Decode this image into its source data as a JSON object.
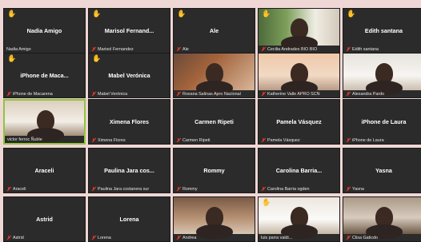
{
  "participants": [
    {
      "display": "Nadia Amigo",
      "label": "Nadia Amigo",
      "hand": true,
      "muted": false,
      "video": false
    },
    {
      "display": "Marisol  Fernand...",
      "label": "Marisol Fernandez",
      "hand": true,
      "muted": true,
      "video": false
    },
    {
      "display": "Ale",
      "label": "Ale",
      "hand": true,
      "muted": true,
      "video": false
    },
    {
      "display": "",
      "label": "Cecilia Andrades BIO BIO",
      "hand": true,
      "muted": true,
      "video": true,
      "bg": "bg-green"
    },
    {
      "display": "Edith santana",
      "label": "Edith santana",
      "hand": true,
      "muted": true,
      "video": false
    },
    {
      "display": "iPhone de Maca...",
      "label": "iPhone de Macarena",
      "hand": true,
      "muted": true,
      "video": false
    },
    {
      "display": "Mabel Verónica",
      "label": "Mabel Verónica",
      "hand": true,
      "muted": true,
      "video": false
    },
    {
      "display": "",
      "label": "Roxana Salinas Apro Nacional",
      "hand": false,
      "muted": true,
      "video": true,
      "bg": "bg-orange"
    },
    {
      "display": "",
      "label": "Katherine Valle APRO SCN",
      "hand": false,
      "muted": true,
      "video": true,
      "bg": "bg-peach"
    },
    {
      "display": "",
      "label": "Alexandra Pardo",
      "hand": false,
      "muted": true,
      "video": true,
      "bg": "bg-white"
    },
    {
      "display": "",
      "label": "victor ferroc Ñuble",
      "hand": false,
      "muted": false,
      "video": true,
      "bg": "bg-room",
      "active": true
    },
    {
      "display": "Ximena Flores",
      "label": "Ximena Flores",
      "hand": false,
      "muted": true,
      "video": false
    },
    {
      "display": "Carmen Ripeti",
      "label": "Carmen Ripeti",
      "hand": false,
      "muted": true,
      "video": false
    },
    {
      "display": "Pamela Vásquez",
      "label": "Pamela Vásquez",
      "hand": false,
      "muted": true,
      "video": false
    },
    {
      "display": "iPhone de Laura",
      "label": "iPhone de Laura",
      "hand": false,
      "muted": true,
      "video": false
    },
    {
      "display": "Araceli",
      "label": "Araceli",
      "hand": false,
      "muted": true,
      "video": false
    },
    {
      "display": "Paulina Jara cos...",
      "label": "Paulina Jara costanera sur",
      "hand": false,
      "muted": true,
      "video": false
    },
    {
      "display": "Rommy",
      "label": "Rommy",
      "hand": false,
      "muted": true,
      "video": false
    },
    {
      "display": "Carolina  Barria...",
      "label": "Carolina  Barria ogden",
      "hand": false,
      "muted": true,
      "video": false
    },
    {
      "display": "Yasna",
      "label": "Yasna",
      "hand": false,
      "muted": true,
      "video": false
    },
    {
      "display": "Astrid",
      "label": "Astrid",
      "hand": false,
      "muted": true,
      "video": false
    },
    {
      "display": "Lorena",
      "label": "Lorena",
      "hand": false,
      "muted": true,
      "video": false
    },
    {
      "display": "",
      "label": "Andrea",
      "hand": false,
      "muted": true,
      "video": true,
      "bg": "bg-brown"
    },
    {
      "display": "",
      "label": "luis parra valdi...",
      "hand": true,
      "muted": false,
      "video": true,
      "bg": "bg-light"
    },
    {
      "display": "",
      "label": "Clisa Gaticdo",
      "hand": false,
      "muted": true,
      "video": true,
      "bg": "bg-tan"
    }
  ]
}
